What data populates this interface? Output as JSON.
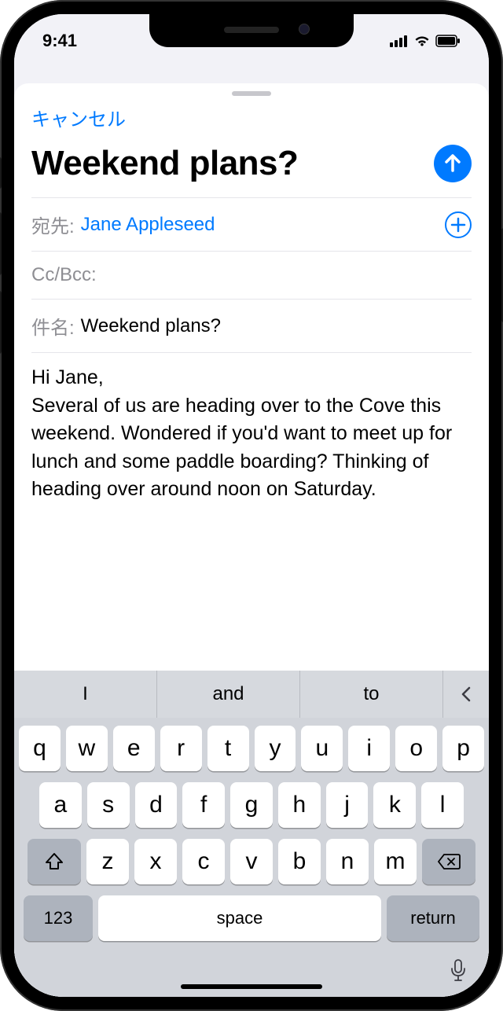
{
  "status": {
    "time": "9:41"
  },
  "compose": {
    "cancel": "キャンセル",
    "title": "Weekend plans?",
    "to_label": "宛先:",
    "to_value": "Jane Appleseed",
    "cc_label": "Cc/Bcc:",
    "subject_label": "件名:",
    "subject_value": "Weekend plans?",
    "body": "Hi Jane,\nSeveral of us are heading over to the Cove this weekend. Wondered if you'd want to meet up for lunch and some paddle boarding? Thinking of heading over around noon on Saturday."
  },
  "keyboard": {
    "suggestions": [
      "I",
      "and",
      "to"
    ],
    "row1": [
      "q",
      "w",
      "e",
      "r",
      "t",
      "y",
      "u",
      "i",
      "o",
      "p"
    ],
    "row2": [
      "a",
      "s",
      "d",
      "f",
      "g",
      "h",
      "j",
      "k",
      "l"
    ],
    "row3": [
      "z",
      "x",
      "c",
      "v",
      "b",
      "n",
      "m"
    ],
    "numbers": "123",
    "space": "space",
    "return": "return"
  }
}
